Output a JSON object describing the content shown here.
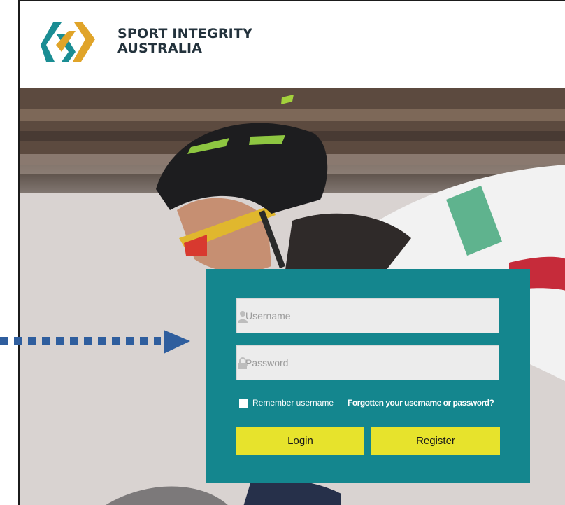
{
  "brand": {
    "line1": "SPORT INTEGRITY",
    "line2": "AUSTRALIA",
    "logo_icon": "linked-diamonds-logo-icon",
    "colors": {
      "teal": "#1a8d93",
      "gold": "#e0a429"
    }
  },
  "login": {
    "username_placeholder": "Username",
    "password_placeholder": "Password",
    "username_icon": "user-icon",
    "password_icon": "lock-icon",
    "remember_label": "Remember username",
    "forgot_link": "Forgotten your username or password?",
    "login_button": "Login",
    "register_button": "Register",
    "panel_color": "#14868e",
    "button_color": "#e7e32c"
  },
  "annotation": {
    "arrow_icon": "dotted-arrow-icon",
    "arrow_color": "#2f5e9e"
  }
}
